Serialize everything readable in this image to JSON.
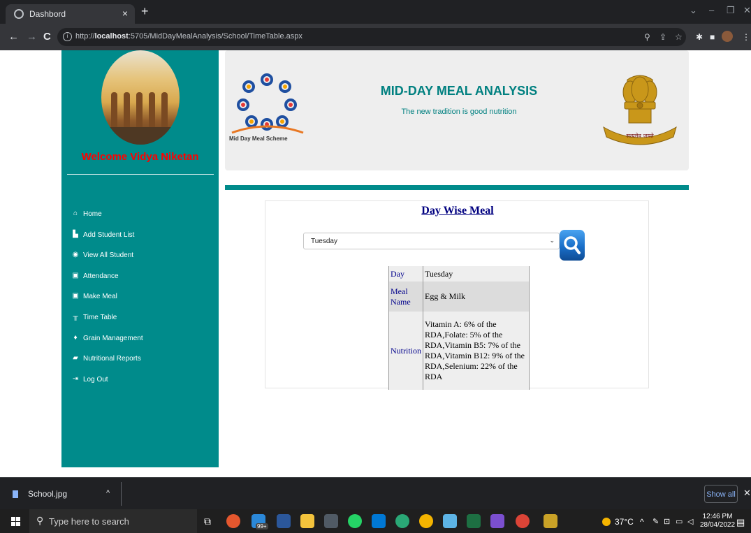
{
  "browser": {
    "tab_title": "Dashbord",
    "tab_close": "×",
    "new_tab": "+",
    "url_prefix": "http://",
    "url_host": "localhost",
    "url_rest": ":5705/MidDayMealAnalysis/School/TimeTable.aspx",
    "back": "←",
    "forward": "→",
    "reload": "C"
  },
  "sidebar": {
    "welcome": "Welcome Vidya Niketan",
    "menu": [
      {
        "label": "Home",
        "icon": "home-icon",
        "glyph": "⌂"
      },
      {
        "label": "Add Student List",
        "icon": "add-student-icon",
        "glyph": "▙"
      },
      {
        "label": "View All Student",
        "icon": "eye-icon",
        "glyph": "◉"
      },
      {
        "label": "Attendance",
        "icon": "attendance-icon",
        "glyph": "▣"
      },
      {
        "label": "Make Meal",
        "icon": "meal-icon",
        "glyph": "▣"
      },
      {
        "label": "Time Table",
        "icon": "timetable-icon",
        "glyph": "╥"
      },
      {
        "label": "Grain Management",
        "icon": "grain-icon",
        "glyph": "♦"
      },
      {
        "label": "Nutritional Reports",
        "icon": "folder-icon",
        "glyph": "▰"
      },
      {
        "label": "Log Out",
        "icon": "logout-icon",
        "glyph": "⇥"
      }
    ]
  },
  "header": {
    "title": "MID-DAY MEAL ANALYSIS",
    "tagline": "The new tradition is good nutrition",
    "logo_caption": "Mid Day Meal Scheme",
    "emblem_text": "सत्यमेव जयते"
  },
  "content": {
    "panel_title": "Day Wise Meal",
    "selected_day": "Tuesday",
    "table": {
      "day_label": "Day",
      "day_value": "Tuesday",
      "meal_label": "Meal Name",
      "meal_value": "Egg & Milk",
      "nutrition_label": "Nutrition",
      "nutrition_value": "Vitamin A: 6% of the RDA,Folate: 5% of the RDA,Vitamin B5: 7% of the RDA,Vitamin B12: 9% of the RDA,Selenium: 22% of the RDA"
    }
  },
  "downloads": {
    "file_name": "School.jpg",
    "show_all": "Show all"
  },
  "taskbar": {
    "search_placeholder": "Type here to search",
    "badge": "99+",
    "temperature": "37°C",
    "time": "12:46 PM",
    "date": "28/04/2022"
  },
  "colors": {
    "sidebar": "#008b8b",
    "welcome": "#ff0000",
    "title": "#008080",
    "panel_title": "#000080"
  }
}
